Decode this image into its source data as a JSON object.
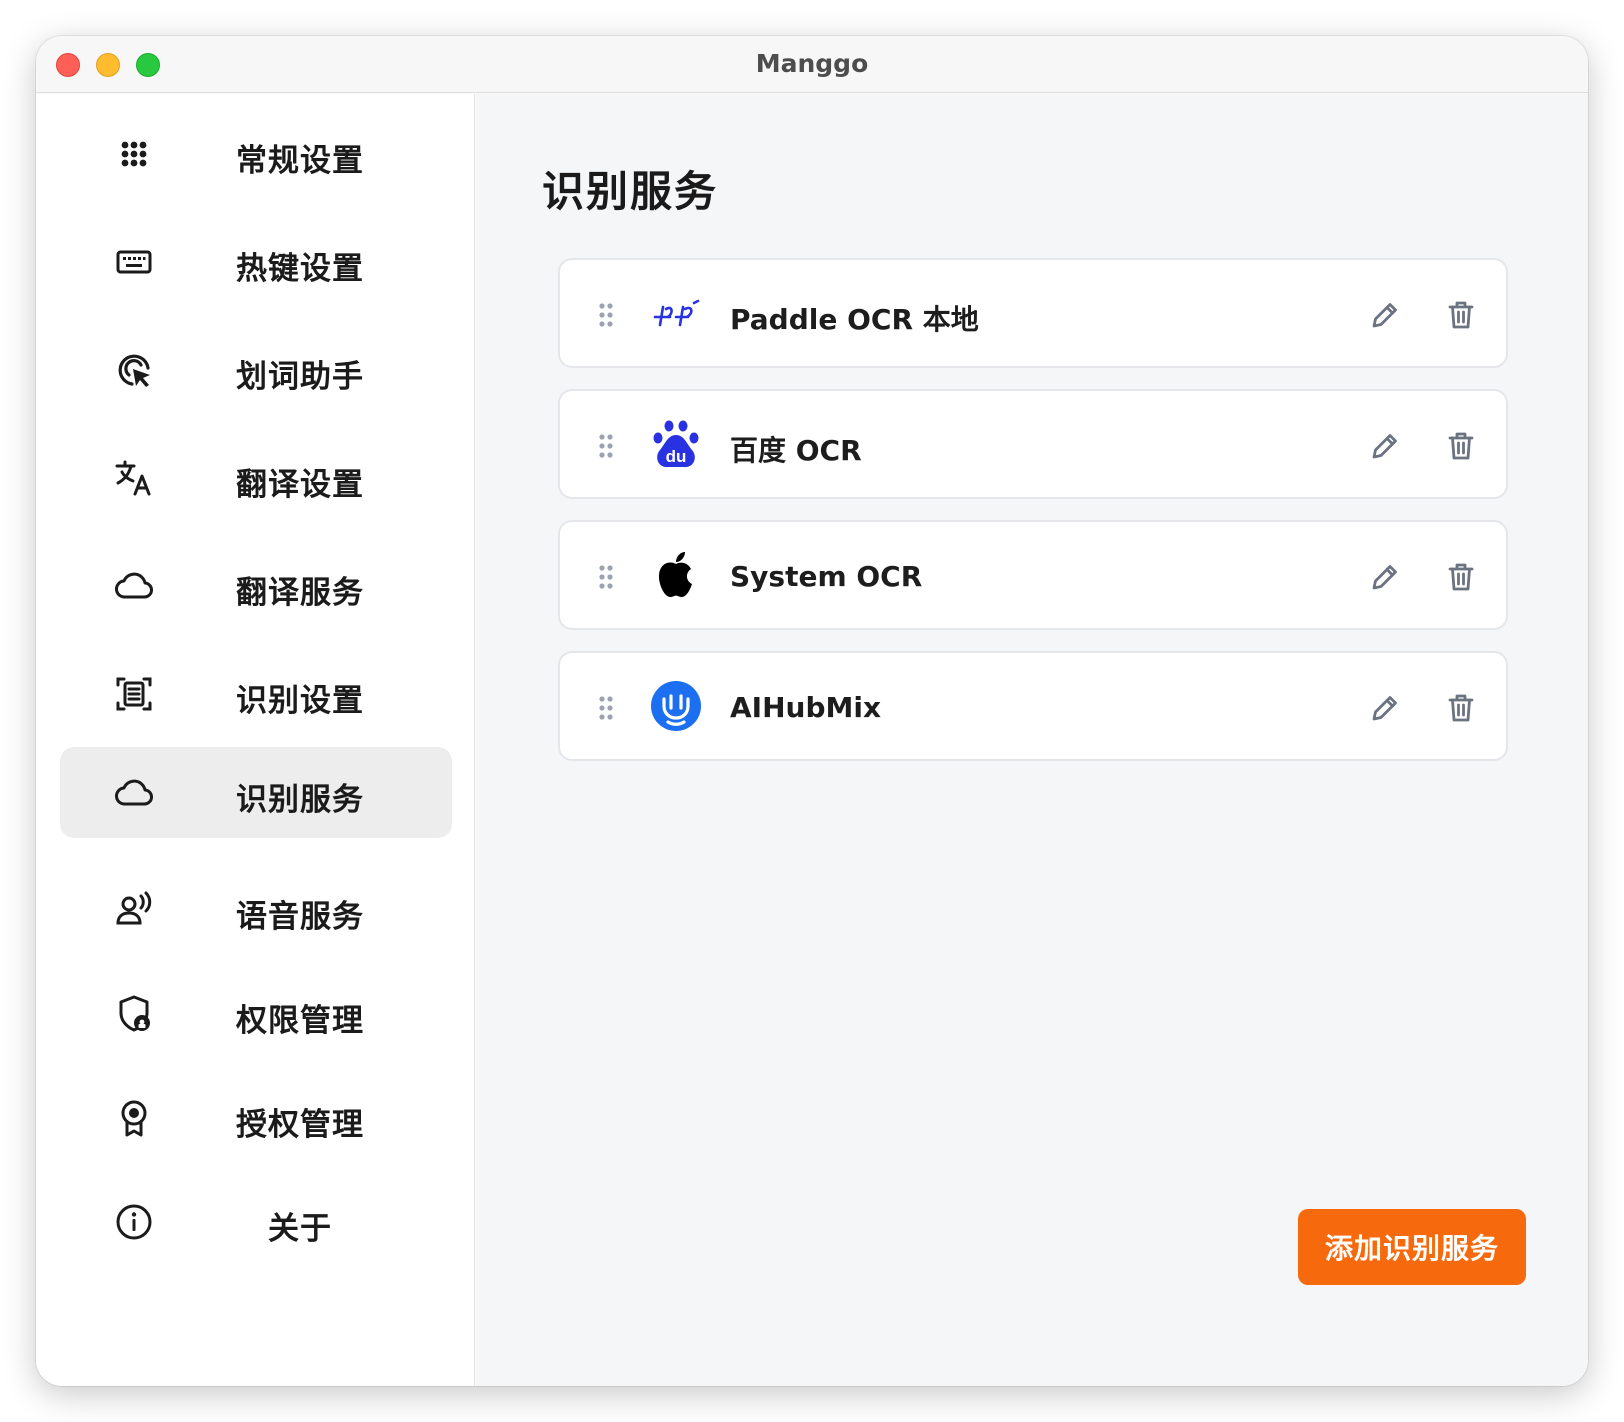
{
  "window": {
    "title": "Manggo"
  },
  "sidebar": {
    "items": [
      {
        "label": "常规设置",
        "icon": "grid-icon",
        "active": false
      },
      {
        "label": "热键设置",
        "icon": "keyboard-icon",
        "active": false
      },
      {
        "label": "划词助手",
        "icon": "cursor-click-icon",
        "active": false
      },
      {
        "label": "翻译设置",
        "icon": "translate-icon",
        "active": false
      },
      {
        "label": "翻译服务",
        "icon": "cloud-icon",
        "active": false
      },
      {
        "label": "识别设置",
        "icon": "scan-text-icon",
        "active": false
      },
      {
        "label": "识别服务",
        "icon": "cloud-icon",
        "active": true
      },
      {
        "label": "语音服务",
        "icon": "user-voice-icon",
        "active": false
      },
      {
        "label": "权限管理",
        "icon": "shield-lock-icon",
        "active": false
      },
      {
        "label": "授权管理",
        "icon": "award-badge-icon",
        "active": false
      },
      {
        "label": "关于",
        "icon": "info-icon",
        "active": false
      }
    ]
  },
  "main": {
    "title": "识别服务",
    "services": [
      {
        "name": "Paddle OCR 本地",
        "logo": "paddle-logo-icon"
      },
      {
        "name": "百度 OCR",
        "logo": "baidu-logo-icon"
      },
      {
        "name": "System OCR",
        "logo": "apple-logo-icon"
      },
      {
        "name": "AIHubMix",
        "logo": "aihubmix-logo-icon"
      }
    ],
    "add_button_label": "添加识别服务"
  },
  "colors": {
    "accent": "#f66a0d",
    "active_nav_bg": "#ededed",
    "icon_gray": "#6b7280"
  }
}
